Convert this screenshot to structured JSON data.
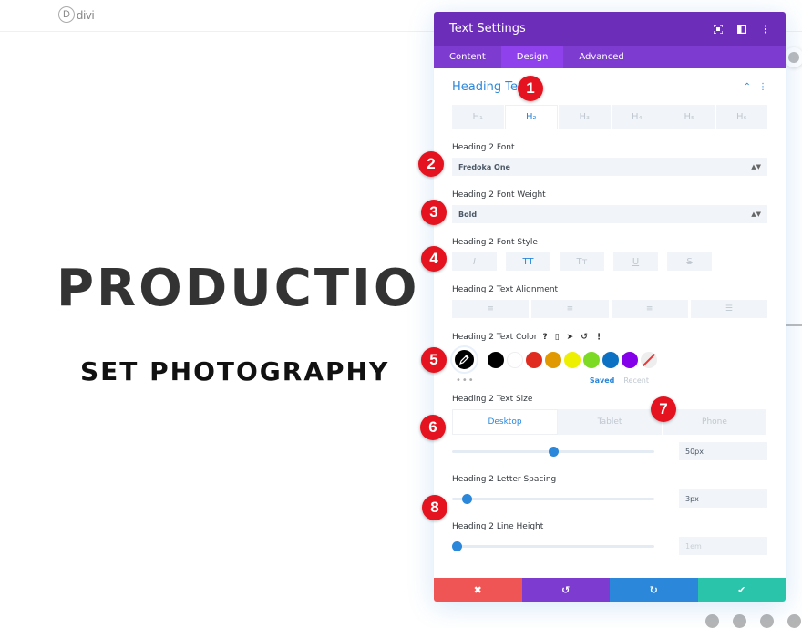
{
  "site": {
    "logo_letter": "D",
    "logo_text": "divi"
  },
  "hero": {
    "title": "PRODUCTIO",
    "subtitle": "SET PHOTOGRAPHY"
  },
  "panel": {
    "title": "Text Settings",
    "header_icons": [
      "fullscreen-icon",
      "sidebar-layout-icon",
      "more-vertical-icon"
    ],
    "tabs": [
      {
        "label": "Content",
        "active": false
      },
      {
        "label": "Design",
        "active": true
      },
      {
        "label": "Advanced",
        "active": false
      }
    ],
    "section_title": "Heading Text",
    "heading_tabs": [
      {
        "label": "H₁",
        "active": false
      },
      {
        "label": "H₂",
        "active": true
      },
      {
        "label": "H₃",
        "active": false
      },
      {
        "label": "H₄",
        "active": false
      },
      {
        "label": "H₅",
        "active": false
      },
      {
        "label": "H₆",
        "active": false
      }
    ],
    "font": {
      "label": "Heading 2 Font",
      "value": "Fredoka One"
    },
    "font_weight": {
      "label": "Heading 2 Font Weight",
      "value": "Bold"
    },
    "font_style": {
      "label": "Heading 2 Font Style",
      "buttons": [
        {
          "name": "italic",
          "glyph": "I",
          "active": false
        },
        {
          "name": "uppercase",
          "glyph": "TT",
          "active": true
        },
        {
          "name": "capitalize",
          "glyph": "Tᴛ",
          "active": false
        },
        {
          "name": "underline",
          "glyph": "U",
          "active": false
        },
        {
          "name": "strikethrough",
          "glyph": "S",
          "active": false
        }
      ]
    },
    "text_alignment": {
      "label": "Heading 2 Text Alignment",
      "buttons": [
        "left",
        "center",
        "right",
        "justify"
      ]
    },
    "text_color": {
      "label": "Heading 2 Text Color",
      "label_icons": [
        "?",
        "▯",
        "➤",
        "↺",
        "⋮"
      ],
      "current": "#000000",
      "swatches": [
        "#000000",
        "#ffffff",
        "#e02b20",
        "#e09900",
        "#edf000",
        "#7cda24",
        "#0c71c3",
        "#8300e9"
      ],
      "saved_label": "Saved",
      "recent_label": "Recent"
    },
    "text_size": {
      "label": "Heading 2 Text Size",
      "devices": [
        {
          "label": "Desktop",
          "active": true
        },
        {
          "label": "Tablet",
          "active": false
        },
        {
          "label": "Phone",
          "active": false
        }
      ],
      "value": "50px",
      "slider_fraction": 0.5
    },
    "letter_spacing": {
      "label": "Heading 2 Letter Spacing",
      "value": "3px",
      "slider_fraction": 0.05
    },
    "line_height": {
      "label": "Heading 2 Line Height",
      "placeholder": "1em",
      "slider_fraction": 0.0
    },
    "footer": {
      "cancel": "✖",
      "undo": "↺",
      "redo": "↻",
      "save": "✔"
    }
  },
  "markers": [
    "1",
    "2",
    "3",
    "4",
    "5",
    "6",
    "7",
    "8"
  ]
}
